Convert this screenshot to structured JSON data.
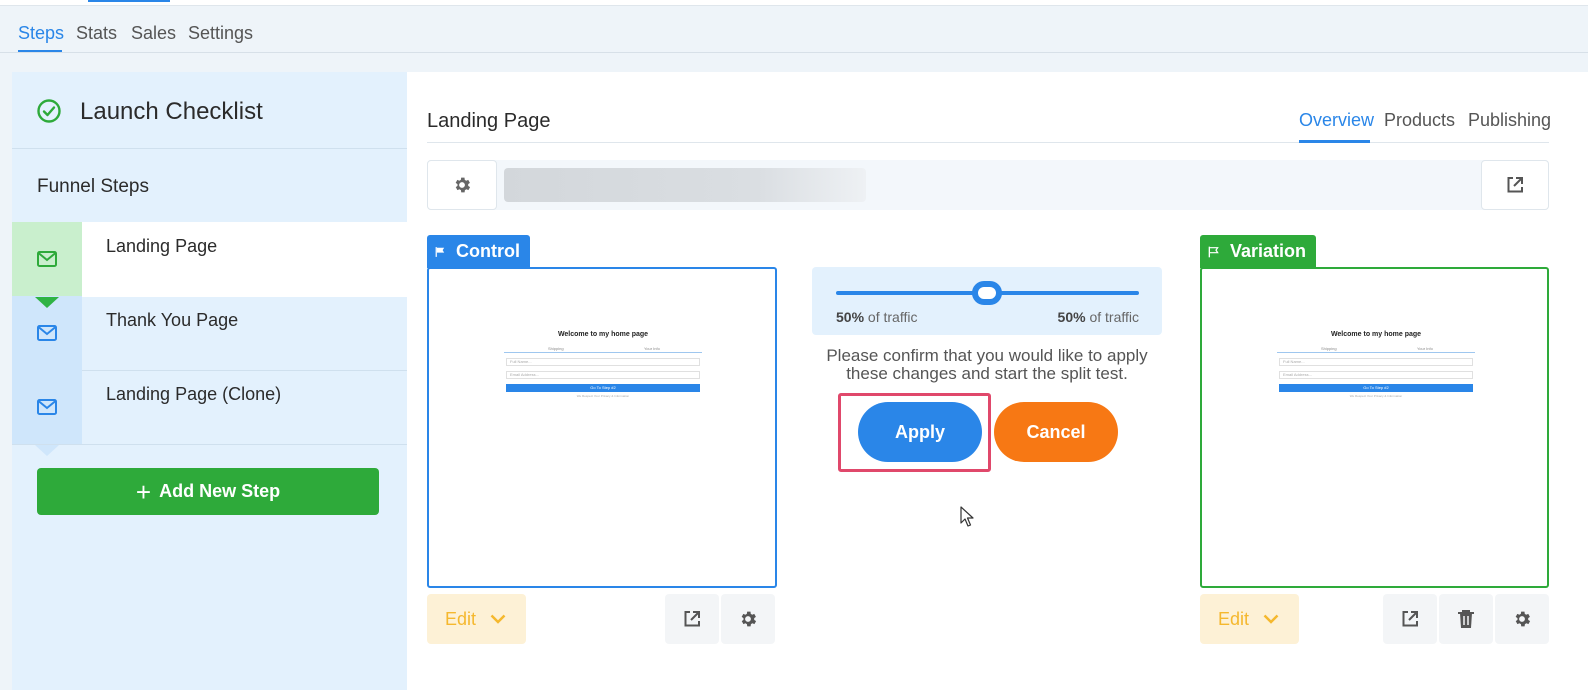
{
  "top_tabs": [
    "Steps",
    "Stats",
    "Sales",
    "Settings"
  ],
  "sidebar": {
    "checklist_title": "Launch Checklist",
    "funnel_steps_title": "Funnel Steps",
    "steps": [
      {
        "label": "Landing Page",
        "icon": "envelope-icon",
        "active": true
      },
      {
        "label": "Thank You Page",
        "icon": "envelope-icon",
        "active": false
      },
      {
        "label": "Landing Page (Clone)",
        "icon": "envelope-icon",
        "active": false
      }
    ],
    "add_step_label": "Add New Step"
  },
  "main": {
    "title": "Landing Page",
    "tabs": [
      "Overview",
      "Products",
      "Publishing"
    ],
    "control": {
      "label": "Control",
      "edit_label": "Edit"
    },
    "variation": {
      "label": "Variation",
      "edit_label": "Edit"
    },
    "preview": {
      "heading": "Welcome to my home page",
      "tab_left": "Shipping",
      "tab_right": "Your Info",
      "field_1": "Full Name...",
      "field_2": "Email Address...",
      "button": "Go To Step #2",
      "note": "We Respect Your Privacy & Information"
    },
    "split": {
      "left_pct": "50%",
      "right_pct": "50%",
      "suffix": "of traffic",
      "value": 0.5,
      "confirm_text": "Please confirm that you would like to apply these changes and start the split test.",
      "apply_label": "Apply",
      "cancel_label": "Cancel"
    }
  },
  "colors": {
    "accent_blue": "#2a86e8",
    "green": "#2eaa3a",
    "orange": "#f77814",
    "highlight": "#e0486b",
    "edit_yellow": "#f5b82e"
  }
}
